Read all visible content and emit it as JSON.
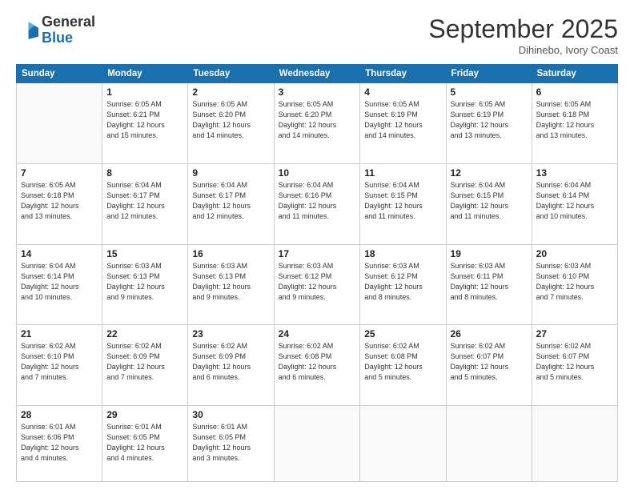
{
  "header": {
    "logo_general": "General",
    "logo_blue": "Blue",
    "month": "September 2025",
    "location": "Dihinebo, Ivory Coast"
  },
  "days_of_week": [
    "Sunday",
    "Monday",
    "Tuesday",
    "Wednesday",
    "Thursday",
    "Friday",
    "Saturday"
  ],
  "weeks": [
    [
      {
        "day": "",
        "info": ""
      },
      {
        "day": "1",
        "info": "Sunrise: 6:05 AM\nSunset: 6:21 PM\nDaylight: 12 hours\nand 15 minutes."
      },
      {
        "day": "2",
        "info": "Sunrise: 6:05 AM\nSunset: 6:20 PM\nDaylight: 12 hours\nand 14 minutes."
      },
      {
        "day": "3",
        "info": "Sunrise: 6:05 AM\nSunset: 6:20 PM\nDaylight: 12 hours\nand 14 minutes."
      },
      {
        "day": "4",
        "info": "Sunrise: 6:05 AM\nSunset: 6:19 PM\nDaylight: 12 hours\nand 14 minutes."
      },
      {
        "day": "5",
        "info": "Sunrise: 6:05 AM\nSunset: 6:19 PM\nDaylight: 12 hours\nand 13 minutes."
      },
      {
        "day": "6",
        "info": "Sunrise: 6:05 AM\nSunset: 6:18 PM\nDaylight: 12 hours\nand 13 minutes."
      }
    ],
    [
      {
        "day": "7",
        "info": "Sunrise: 6:05 AM\nSunset: 6:18 PM\nDaylight: 12 hours\nand 13 minutes."
      },
      {
        "day": "8",
        "info": "Sunrise: 6:04 AM\nSunset: 6:17 PM\nDaylight: 12 hours\nand 12 minutes."
      },
      {
        "day": "9",
        "info": "Sunrise: 6:04 AM\nSunset: 6:17 PM\nDaylight: 12 hours\nand 12 minutes."
      },
      {
        "day": "10",
        "info": "Sunrise: 6:04 AM\nSunset: 6:16 PM\nDaylight: 12 hours\nand 11 minutes."
      },
      {
        "day": "11",
        "info": "Sunrise: 6:04 AM\nSunset: 6:15 PM\nDaylight: 12 hours\nand 11 minutes."
      },
      {
        "day": "12",
        "info": "Sunrise: 6:04 AM\nSunset: 6:15 PM\nDaylight: 12 hours\nand 11 minutes."
      },
      {
        "day": "13",
        "info": "Sunrise: 6:04 AM\nSunset: 6:14 PM\nDaylight: 12 hours\nand 10 minutes."
      }
    ],
    [
      {
        "day": "14",
        "info": "Sunrise: 6:04 AM\nSunset: 6:14 PM\nDaylight: 12 hours\nand 10 minutes."
      },
      {
        "day": "15",
        "info": "Sunrise: 6:03 AM\nSunset: 6:13 PM\nDaylight: 12 hours\nand 9 minutes."
      },
      {
        "day": "16",
        "info": "Sunrise: 6:03 AM\nSunset: 6:13 PM\nDaylight: 12 hours\nand 9 minutes."
      },
      {
        "day": "17",
        "info": "Sunrise: 6:03 AM\nSunset: 6:12 PM\nDaylight: 12 hours\nand 9 minutes."
      },
      {
        "day": "18",
        "info": "Sunrise: 6:03 AM\nSunset: 6:12 PM\nDaylight: 12 hours\nand 8 minutes."
      },
      {
        "day": "19",
        "info": "Sunrise: 6:03 AM\nSunset: 6:11 PM\nDaylight: 12 hours\nand 8 minutes."
      },
      {
        "day": "20",
        "info": "Sunrise: 6:03 AM\nSunset: 6:10 PM\nDaylight: 12 hours\nand 7 minutes."
      }
    ],
    [
      {
        "day": "21",
        "info": "Sunrise: 6:02 AM\nSunset: 6:10 PM\nDaylight: 12 hours\nand 7 minutes."
      },
      {
        "day": "22",
        "info": "Sunrise: 6:02 AM\nSunset: 6:09 PM\nDaylight: 12 hours\nand 7 minutes."
      },
      {
        "day": "23",
        "info": "Sunrise: 6:02 AM\nSunset: 6:09 PM\nDaylight: 12 hours\nand 6 minutes."
      },
      {
        "day": "24",
        "info": "Sunrise: 6:02 AM\nSunset: 6:08 PM\nDaylight: 12 hours\nand 6 minutes."
      },
      {
        "day": "25",
        "info": "Sunrise: 6:02 AM\nSunset: 6:08 PM\nDaylight: 12 hours\nand 5 minutes."
      },
      {
        "day": "26",
        "info": "Sunrise: 6:02 AM\nSunset: 6:07 PM\nDaylight: 12 hours\nand 5 minutes."
      },
      {
        "day": "27",
        "info": "Sunrise: 6:02 AM\nSunset: 6:07 PM\nDaylight: 12 hours\nand 5 minutes."
      }
    ],
    [
      {
        "day": "28",
        "info": "Sunrise: 6:01 AM\nSunset: 6:06 PM\nDaylight: 12 hours\nand 4 minutes."
      },
      {
        "day": "29",
        "info": "Sunrise: 6:01 AM\nSunset: 6:05 PM\nDaylight: 12 hours\nand 4 minutes."
      },
      {
        "day": "30",
        "info": "Sunrise: 6:01 AM\nSunset: 6:05 PM\nDaylight: 12 hours\nand 3 minutes."
      },
      {
        "day": "",
        "info": ""
      },
      {
        "day": "",
        "info": ""
      },
      {
        "day": "",
        "info": ""
      },
      {
        "day": "",
        "info": ""
      }
    ]
  ]
}
